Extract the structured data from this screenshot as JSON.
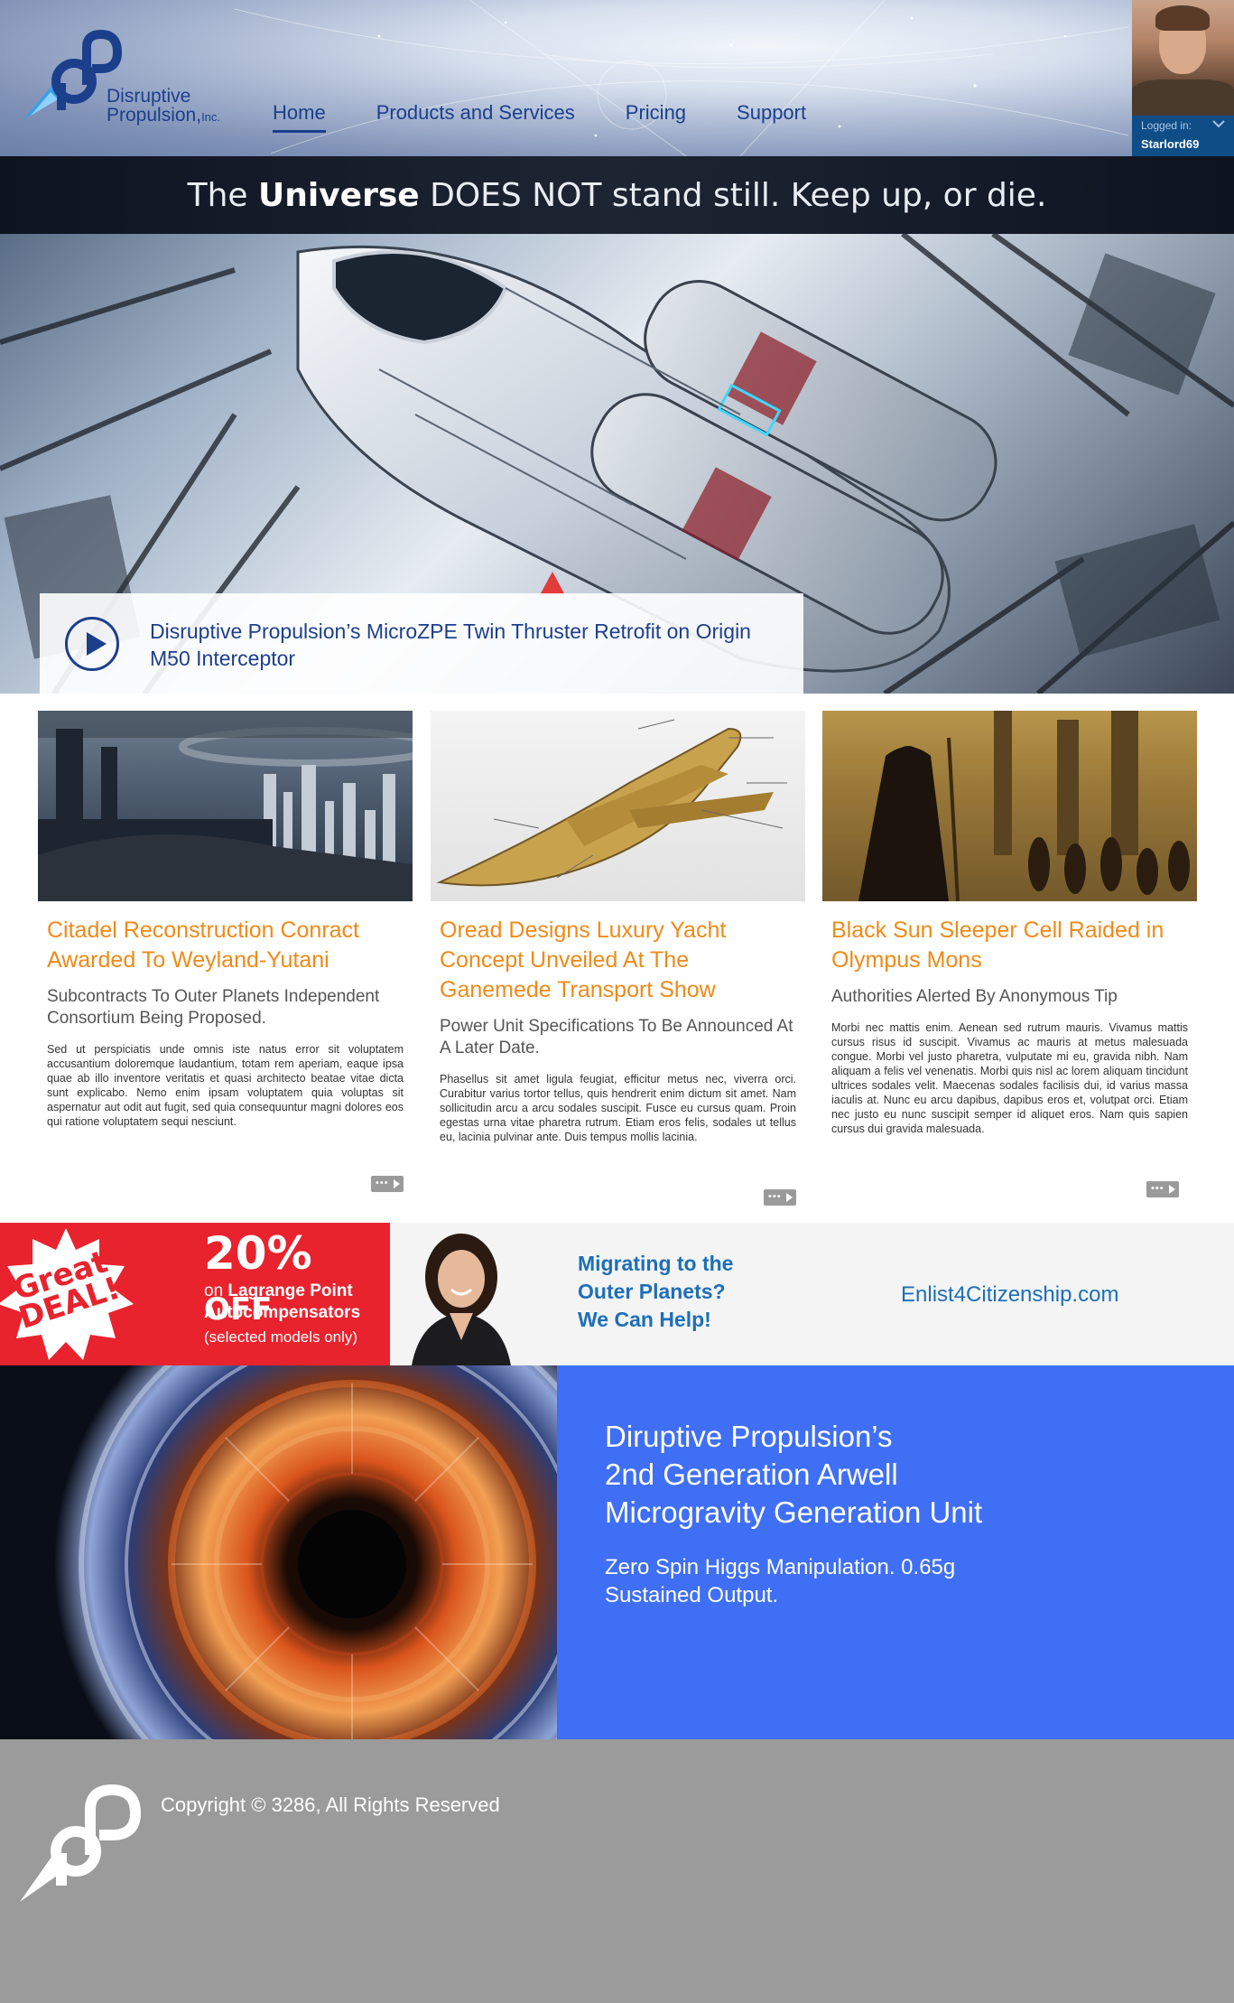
{
  "brand": {
    "name_line1": "Disruptive",
    "name_line2": "Propulsion,",
    "name_suffix": "Inc."
  },
  "nav": {
    "items": [
      {
        "label": "Home",
        "active": true
      },
      {
        "label": "Products and Services",
        "active": false
      },
      {
        "label": "Pricing",
        "active": false
      },
      {
        "label": "Support",
        "active": false
      }
    ]
  },
  "user": {
    "logged_in_label": "Logged in:",
    "username": "Starlord69"
  },
  "tagline": {
    "prefix": "The ",
    "bold": "Universe",
    "suffix": " DOES NOT stand still. Keep up, or die."
  },
  "hero": {
    "video_title": "Disruptive Propulsion’s MicroZPE Twin Thruster Retrofit on Origin M50 Interceptor"
  },
  "articles": [
    {
      "headline": "Citadel Reconstruction Conract Awarded To Weyland-Yutani",
      "subhead": "Subcontracts To Outer Planets Independent Consortium Being Proposed.",
      "body": "Sed ut perspiciatis unde omnis iste natus error sit voluptatem accusantium doloremque laudantium, totam rem aperiam, eaque ipsa quae ab illo inventore veritatis et quasi architecto beatae vitae dicta sunt explicabo. Nemo enim ipsam voluptatem quia voluptas sit aspernatur aut odit aut fugit, sed quia consequuntur magni dolores eos qui ratione voluptatem sequi nesciunt."
    },
    {
      "headline": "Oread Designs Luxury Yacht Concept Unveiled At The Ganemede Transport Show",
      "subhead": "Power Unit Specifications To Be Announced At A Later Date.",
      "body": "Phasellus sit amet ligula feugiat, efficitur metus nec, viverra orci. Curabitur varius tortor tellus, quis hendrerit enim dictum sit amet. Nam sollicitudin arcu a arcu sodales suscipit. Fusce eu cursus quam. Proin egestas urna vitae pharetra rutrum. Etiam eros felis, sodales ut tellus eu, lacinia pulvinar ante. Duis tempus mollis lacinia."
    },
    {
      "headline": "Black Sun Sleeper Cell Raided in Olympus Mons",
      "subhead": "Authorities Alerted By Anonymous Tip",
      "body": "Morbi nec mattis enim. Aenean sed rutrum mauris. Vivamus mattis cursus risus id suscipit. Vivamus ac mauris at metus malesuada congue. Morbi vel justo pharetra, vulputate mi eu, gravida nibh. Nam aliquam a felis vel venenatis. Morbi quis nisl ac lorem aliquam tincidunt ultrices sodales velit. Maecenas sodales facilisis dui, id varius massa iaculis at. Nunc eu arcu dapibus, dapibus eros et, volutpat orci. Etiam nec justo eu nunc suscipit semper id aliquet eros. Nam quis sapien cursus dui gravida malesuada."
    }
  ],
  "ad": {
    "badge_line1": "Great",
    "badge_line2": "DEAL!",
    "percent": "20%",
    "off": "OFF",
    "on_prefix": "on ",
    "on_product": "Lagrange Point",
    "product_line2": "Autocompensators",
    "note": "(selected models only)",
    "migrate_line1": "Migrating to the",
    "migrate_line2": "Outer Planets?",
    "migrate_line3": "We Can Help!",
    "link": "Enlist4Citizenship.com"
  },
  "feature": {
    "title_line1": "Diruptive Propulsion’s",
    "title_line2": "2nd Generation Arwell",
    "title_line3": "Microgravity Generation Unit",
    "sub_line1": "Zero Spin Higgs Manipulation. 0.65g",
    "sub_line2": "Sustained Output."
  },
  "footer": {
    "copyright": "Copyright © 3286, All Rights Reserved"
  },
  "colors": {
    "brand_blue": "#1c3f8c",
    "headline_orange": "#f08a17",
    "deal_red": "#e8232e",
    "feature_blue": "#3f6ff5",
    "footer_gray": "#9b9b9b"
  }
}
